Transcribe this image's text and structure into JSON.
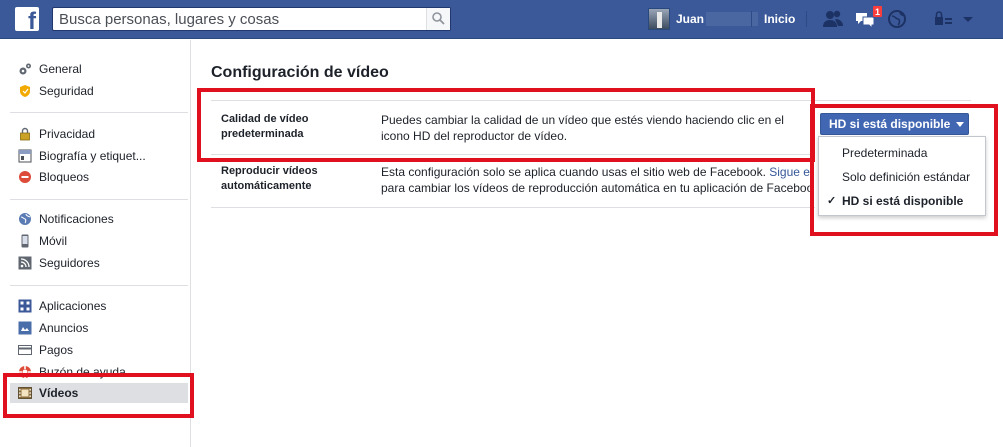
{
  "topbar": {
    "logo": "f",
    "search_placeholder": "Busca personas, lugares y cosas",
    "user_name": "Juan",
    "home_label": "Inicio",
    "notification_count": "1"
  },
  "sidebar": {
    "groups": [
      [
        {
          "label": "General",
          "icon": "gears-icon"
        },
        {
          "label": "Seguridad",
          "icon": "shield-icon"
        }
      ],
      [
        {
          "label": "Privacidad",
          "icon": "padlock-icon"
        },
        {
          "label": "Biografía y etiquet...",
          "icon": "timeline-icon"
        },
        {
          "label": "Bloqueos",
          "icon": "block-icon"
        }
      ],
      [
        {
          "label": "Notificaciones",
          "icon": "globe-icon"
        },
        {
          "label": "Móvil",
          "icon": "mobile-icon"
        },
        {
          "label": "Seguidores",
          "icon": "rss-icon"
        }
      ],
      [
        {
          "label": "Aplicaciones",
          "icon": "apps-icon"
        },
        {
          "label": "Anuncios",
          "icon": "ads-icon"
        },
        {
          "label": "Pagos",
          "icon": "card-icon"
        },
        {
          "label": "Buzón de ayuda",
          "icon": "lifebuoy-icon"
        },
        {
          "label": "Vídeos",
          "icon": "film-icon",
          "active": true
        }
      ]
    ]
  },
  "main": {
    "title": "Configuración de vídeo",
    "rows": [
      {
        "label_line1": "Calidad de vídeo",
        "label_line2": "predeterminada",
        "desc_line1": "Puedes cambiar la calidad de un vídeo que estés viendo haciendo clic en el",
        "desc_line2": "icono HD del reproductor de vídeo."
      },
      {
        "label_line1": "Reproducir vídeos",
        "label_line2": "automáticamente",
        "desc_line1": "Esta configuración solo se aplica cuando usas el sitio web de Facebook.",
        "desc_link": "Sigue e",
        "desc_line2": "para cambiar los vídeos de reproducción automática en tu aplicación de Faceboo"
      }
    ],
    "dropdown": {
      "selected": "HD si está disponible",
      "options": [
        "Predeterminada",
        "Solo definición estándar",
        "HD si está disponible"
      ],
      "checkmark": "✓"
    }
  },
  "colors": {
    "brand": "#3b5998",
    "button": "#4267b2",
    "highlight_box": "#e0101f",
    "link": "#365899"
  }
}
